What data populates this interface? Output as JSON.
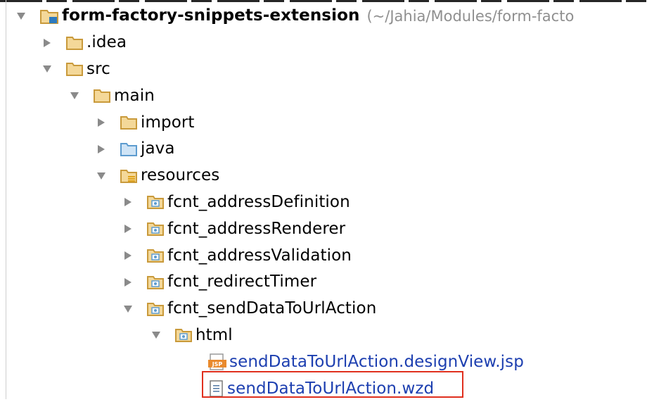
{
  "tree": {
    "root": {
      "name": "form-factory-snippets-extension",
      "path": "(~/Jahia/Modules/form-facto"
    },
    "idea": {
      "name": ".idea"
    },
    "src": {
      "name": "src"
    },
    "main": {
      "name": "main"
    },
    "import": {
      "name": "import"
    },
    "java": {
      "name": "java"
    },
    "resources": {
      "name": "resources"
    },
    "address_definition": {
      "name": "fcnt_addressDefinition"
    },
    "address_renderer": {
      "name": "fcnt_addressRenderer"
    },
    "address_validation": {
      "name": "fcnt_addressValidation"
    },
    "redirect_timer": {
      "name": "fcnt_redirectTimer"
    },
    "send_data": {
      "name": "fcnt_sendDataToUrlAction"
    },
    "html": {
      "name": "html"
    },
    "jsp_file": {
      "name": "sendDataToUrlAction.designView.jsp",
      "badge": "JSP"
    },
    "wzd_file": {
      "name": "sendDataToUrlAction.wzd"
    }
  },
  "colors": {
    "folder": "#c99a3b",
    "package_folder": "#5d9ccf",
    "file_link": "#1d3fb0",
    "highlight": "#e0301e",
    "path_text": "#8f8f8f"
  },
  "icons": {
    "expanded": "triangle-down-icon",
    "collapsed": "triangle-right-icon",
    "folder": "folder-icon",
    "module_folder": "module-folder-icon",
    "source_folder": "source-folder-icon",
    "resources_folder": "resources-folder-icon",
    "package_folder": "package-folder-icon",
    "jsp_file": "jsp-file-icon",
    "text_file": "text-file-icon"
  }
}
